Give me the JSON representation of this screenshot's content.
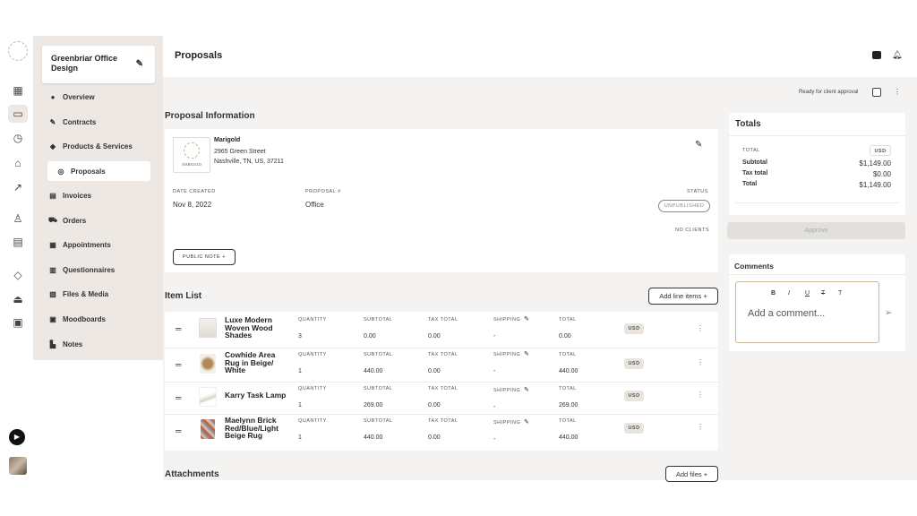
{
  "rail": {
    "icons": [
      "logo-icon",
      "dashboard-icon",
      "folder-icon",
      "timer-icon",
      "bank-icon",
      "trend-icon",
      "person-icon",
      "calendar-store-icon",
      "tag-icon",
      "boat-icon",
      "archive-icon"
    ]
  },
  "project": {
    "name": "Greenbriar Office Design"
  },
  "nav": [
    {
      "label": "Overview",
      "icon": "●"
    },
    {
      "label": "Contracts",
      "icon": "✎"
    },
    {
      "label": "Products & Services",
      "icon": "◆"
    },
    {
      "label": "Proposals",
      "icon": "◎"
    },
    {
      "label": "Invoices",
      "icon": "▤"
    },
    {
      "label": "Orders",
      "icon": "⛟"
    },
    {
      "label": "Appointments",
      "icon": "▦"
    },
    {
      "label": "Questionnaires",
      "icon": "▥"
    },
    {
      "label": "Files & Media",
      "icon": "▧"
    },
    {
      "label": "Moodboards",
      "icon": "▣"
    },
    {
      "label": "Notes",
      "icon": "▙"
    }
  ],
  "header": {
    "title": "Proposals"
  },
  "approval": {
    "label": "Ready for client approval"
  },
  "proposal_info": {
    "heading": "Proposal Information",
    "vendor_name": "Marigold",
    "logo_text": "MARIGOLD",
    "address1": "2965 Green Street",
    "address2": "Nashville, TN, US, 37211",
    "date_label": "DATE CREATED",
    "date": "Nov 8, 2022",
    "number_label": "PROPOSAL #",
    "number": "Office",
    "status_label": "STATUS",
    "status": "UNPUBLISHED",
    "clients": "NO CLIENTS",
    "public_note": "PUBLIC NOTE +"
  },
  "item_list": {
    "heading": "Item List",
    "add_label": "Add line items +",
    "col_labels": {
      "qty": "QUANTITY",
      "subtotal": "SUBTOTAL",
      "tax": "TAX TOTAL",
      "shipping": "SHIPPING",
      "total": "TOTAL"
    },
    "items": [
      {
        "name": "Luxe Modern Woven Wood Shades",
        "qty": "3",
        "subtotal": "0.00",
        "tax": "0.00",
        "shipping": "-",
        "total": "0.00",
        "currency": "USD"
      },
      {
        "name": "Cowhide Area Rug in Beige/ White",
        "qty": "1",
        "subtotal": "440.00",
        "tax": "0.00",
        "shipping": "-",
        "total": "440.00",
        "currency": "USD"
      },
      {
        "name": "Karry Task Lamp",
        "qty": "1",
        "subtotal": "269.00",
        "tax": "0.00",
        "shipping": "-",
        "total": "269.00",
        "currency": "USD"
      },
      {
        "name": "Maelynn Brick Red/Blue/Light Beige Rug",
        "qty": "1",
        "subtotal": "440.00",
        "tax": "0.00",
        "shipping": "-",
        "total": "440.00",
        "currency": "USD"
      }
    ]
  },
  "attachments": {
    "heading": "Attachments",
    "add_label": "Add files +"
  },
  "totals": {
    "heading": "Totals",
    "total_label": "TOTAL",
    "currency": "USD",
    "rows": [
      {
        "label": "Subtotal",
        "value": "$1,149.00"
      },
      {
        "label": "Tax total",
        "value": "$0.00"
      },
      {
        "label": "Total",
        "value": "$1,149.00"
      }
    ],
    "approve": "Approve"
  },
  "comments": {
    "heading": "Comments",
    "placeholder": "Add a comment...",
    "toolbar": [
      "B",
      "I",
      "U",
      "T",
      "T"
    ]
  },
  "colors": {
    "sidebar": "#ede8e3",
    "content_bg": "#f4f3f2",
    "accent": "#c9b79c"
  }
}
